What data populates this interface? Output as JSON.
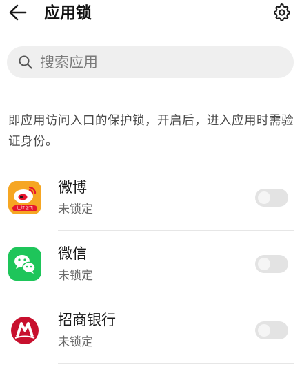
{
  "header": {
    "title": "应用锁",
    "back_icon": "back-arrow-icon",
    "settings_icon": "gear-icon"
  },
  "search": {
    "placeholder": "搜索应用",
    "icon": "search-icon"
  },
  "description": "即应用访问入口的保护锁，开启后，进入应用时需验证身份。",
  "apps": [
    {
      "name": "微博",
      "status": "未锁定",
      "locked": false,
      "icon": "weibo-icon",
      "icon_badge": "让红包飞"
    },
    {
      "name": "微信",
      "status": "未锁定",
      "locked": false,
      "icon": "wechat-icon"
    },
    {
      "name": "招商银行",
      "status": "未锁定",
      "locked": false,
      "icon": "cmb-icon"
    }
  ],
  "colors": {
    "weibo_bg": "#f6a623",
    "weibo_red": "#e6162d",
    "wechat_green": "#1ec55a",
    "cmb_red": "#c8102e",
    "toggle_off": "#e3e3e3"
  }
}
